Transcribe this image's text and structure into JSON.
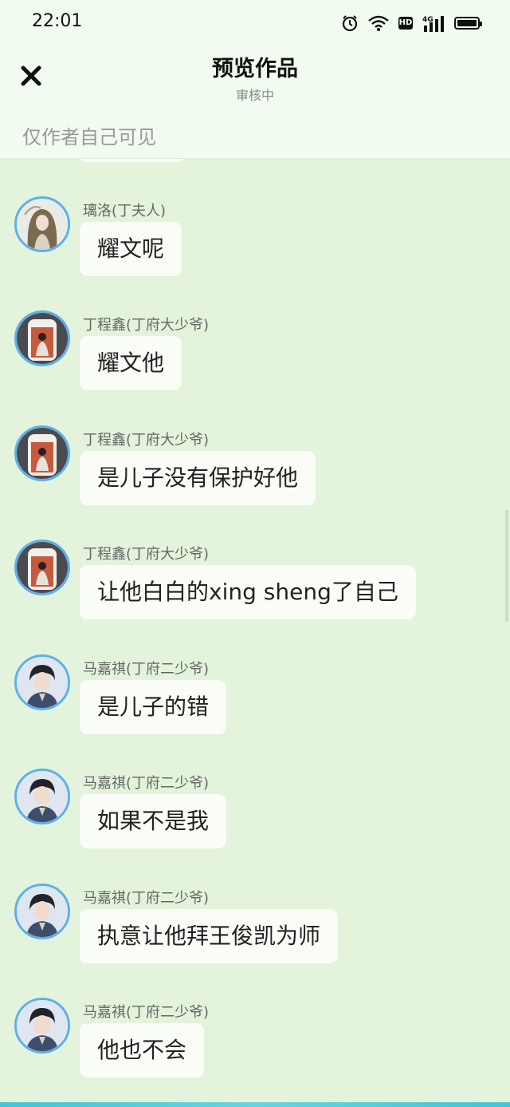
{
  "status_bar": {
    "time": "22:01",
    "network": "4G",
    "icons": [
      "alarm-icon",
      "wifi-icon",
      "hd-icon",
      "signal-4g-icon",
      "battery-icon"
    ]
  },
  "header": {
    "title": "预览作品",
    "subtitle": "审核中",
    "close_icon": "close-icon"
  },
  "visibility_note": "仅作者自己可见",
  "messages": [
    {
      "sender": "璃洛(丁夫人)",
      "text": "耀文呢",
      "avatar": "female-avatar"
    },
    {
      "sender": "丁程鑫(丁府大少爷)",
      "text": "耀文他",
      "avatar": "portrait-avatar"
    },
    {
      "sender": "丁程鑫(丁府大少爷)",
      "text": "是儿子没有保护好他",
      "avatar": "portrait-avatar"
    },
    {
      "sender": "丁程鑫(丁府大少爷)",
      "text": "让他白白的xing sheng了自己",
      "avatar": "portrait-avatar"
    },
    {
      "sender": "马嘉祺(丁府二少爷)",
      "text": "是儿子的错",
      "avatar": "young-man-avatar"
    },
    {
      "sender": "马嘉祺(丁府二少爷)",
      "text": "如果不是我",
      "avatar": "young-man-avatar"
    },
    {
      "sender": "马嘉祺(丁府二少爷)",
      "text": "执意让他拜王俊凯为师",
      "avatar": "young-man-avatar"
    },
    {
      "sender": "马嘉祺(丁府二少爷)",
      "text": "他也不会",
      "avatar": "young-man-avatar"
    }
  ],
  "colors": {
    "header_bg": "#f1fbf0",
    "chat_bg": "#e4f3dc",
    "bubble_bg": "#fafdf7",
    "avatar_ring": "#5cb1e8",
    "bottom_accent": "#41c6d8"
  }
}
